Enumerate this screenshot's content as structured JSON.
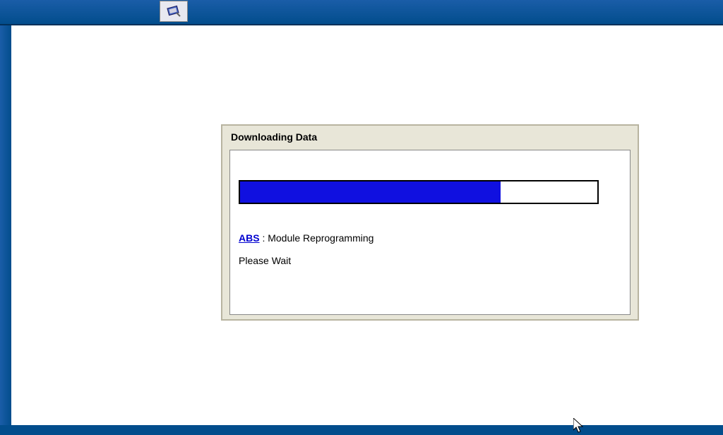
{
  "titlebar": {
    "icon_name": "diagnostic-scanner-icon"
  },
  "dialog": {
    "title": "Downloading Data",
    "progress_percent": 73,
    "module_link": "ABS",
    "module_text": " : Module Reprogramming",
    "wait_text": "Please Wait"
  }
}
